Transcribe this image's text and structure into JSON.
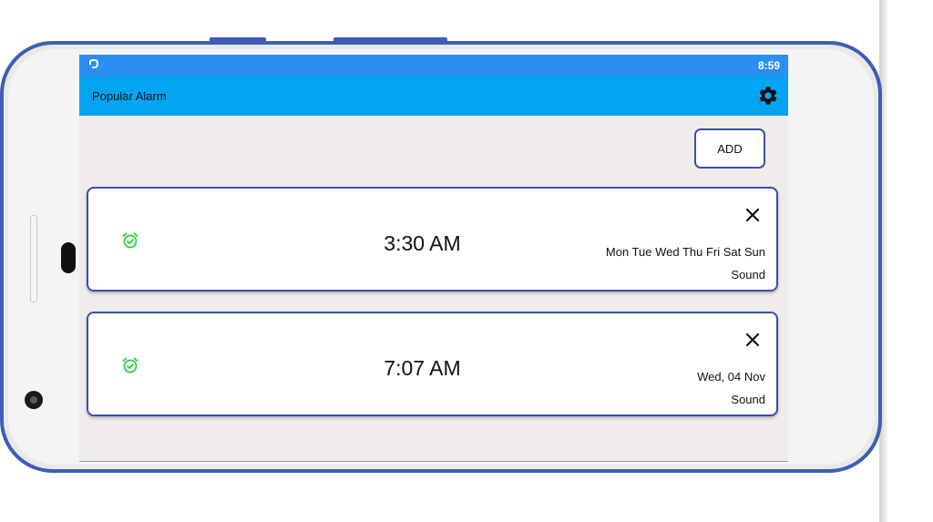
{
  "status_bar": {
    "time": "8:59"
  },
  "app_bar": {
    "title": "Popular Alarm"
  },
  "toolbar": {
    "add_label": "ADD"
  },
  "alarms": [
    {
      "time": "3:30 AM",
      "days": "Mon Tue Wed Thu Fri Sat Sun",
      "sound": "Sound"
    },
    {
      "time": "7:07 AM",
      "days": "Wed, 04 Nov",
      "sound": "Sound"
    }
  ],
  "icons": {
    "status": "notification-app-icon",
    "settings": "gear-icon",
    "alarm": "alarm-clock-check-icon",
    "close": "close-icon"
  },
  "colors": {
    "status_bar": "#2a8ff0",
    "app_bar": "#03a5f2",
    "screen_bg": "#efeceb",
    "card_border": "#3b4fa8",
    "alarm_icon": "#2ecc40",
    "phone_frame": "#3f5db4"
  }
}
